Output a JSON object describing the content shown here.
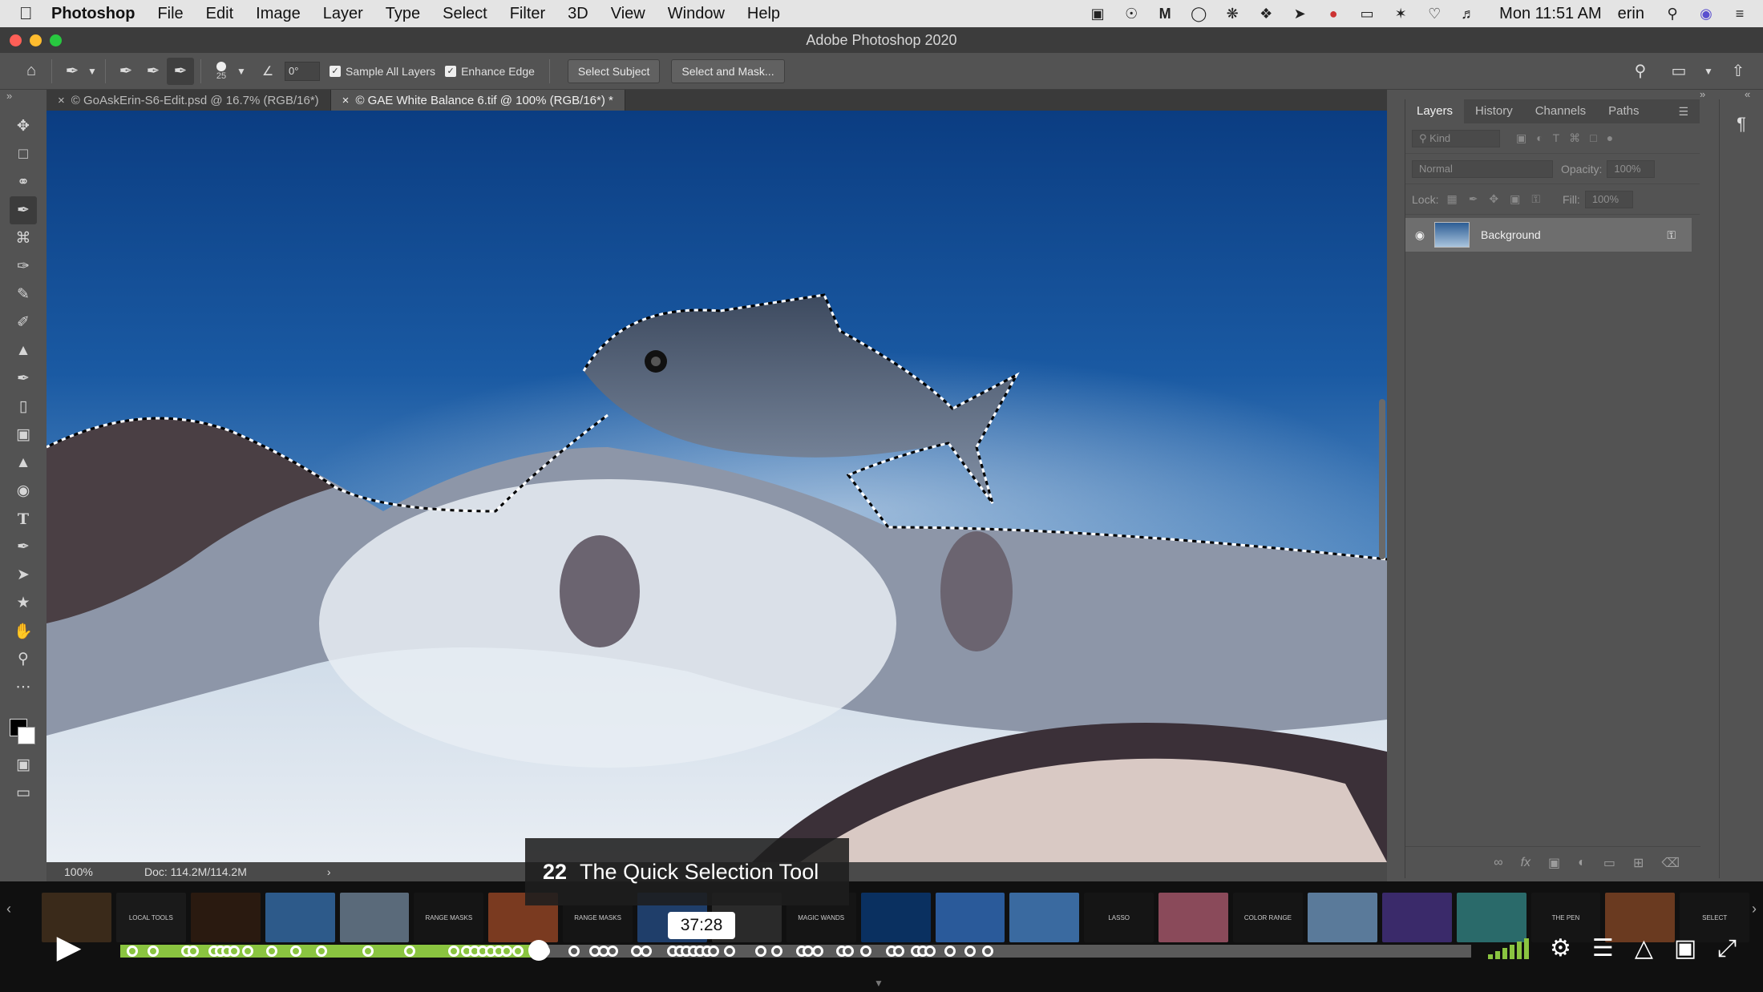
{
  "menubar": {
    "apple": "",
    "app": "Photoshop",
    "items": [
      "File",
      "Edit",
      "Image",
      "Layer",
      "Type",
      "Select",
      "Filter",
      "3D",
      "View",
      "Window",
      "Help"
    ],
    "clock": "Mon 11:51 AM",
    "user": "erin"
  },
  "window": {
    "title": "Adobe Photoshop 2020"
  },
  "options": {
    "brush_size": "25",
    "angle": "0°",
    "sample_all_layers": "Sample All Layers",
    "enhance_edge": "Enhance Edge",
    "select_subject": "Select Subject",
    "select_and_mask": "Select and Mask..."
  },
  "tabs": [
    {
      "label": "© GoAskErin-S6-Edit.psd @ 16.7% (RGB/16*)"
    },
    {
      "label": "© GAE White Balance 6.tif @ 100% (RGB/16*) *"
    }
  ],
  "status": {
    "zoom": "100%",
    "doc": "Doc: 114.2M/114.2M",
    "arrow": "›"
  },
  "layers_panel": {
    "tabs": [
      "Layers",
      "History",
      "Channels",
      "Paths"
    ],
    "kind": "Kind",
    "blend": "Normal",
    "opacity_label": "Opacity:",
    "opacity": "100%",
    "lock_label": "Lock:",
    "fill_label": "Fill:",
    "fill": "100%",
    "layer_name": "Background"
  },
  "video": {
    "chapter_num": "22",
    "chapter_title": "The Quick Selection Tool",
    "time": "37:28",
    "progress": 0.31,
    "chapters": [
      {
        "label": ""
      },
      {
        "label": "LOCAL TOOLS"
      },
      {
        "label": ""
      },
      {
        "label": ""
      },
      {
        "label": ""
      },
      {
        "label": "RANGE MASKS"
      },
      {
        "label": ""
      },
      {
        "label": "RANGE MASKS"
      },
      {
        "label": ""
      },
      {
        "label": ""
      },
      {
        "label": "MAGIC WANDS"
      },
      {
        "label": ""
      },
      {
        "label": ""
      },
      {
        "label": ""
      },
      {
        "label": "LASSO"
      },
      {
        "label": ""
      },
      {
        "label": "COLOR RANGE"
      },
      {
        "label": ""
      },
      {
        "label": ""
      },
      {
        "label": ""
      },
      {
        "label": "THE PEN"
      },
      {
        "label": ""
      },
      {
        "label": "SELECT"
      }
    ],
    "markers": [
      0.005,
      0.02,
      0.045,
      0.05,
      0.065,
      0.07,
      0.075,
      0.08,
      0.09,
      0.108,
      0.126,
      0.145,
      0.179,
      0.21,
      0.243,
      0.252,
      0.258,
      0.264,
      0.27,
      0.276,
      0.282,
      0.29,
      0.31,
      0.332,
      0.347,
      0.354,
      0.36,
      0.378,
      0.385,
      0.405,
      0.41,
      0.415,
      0.42,
      0.425,
      0.43,
      0.435,
      0.447,
      0.47,
      0.482,
      0.5,
      0.505,
      0.512,
      0.53,
      0.535,
      0.548,
      0.567,
      0.572,
      0.585,
      0.59,
      0.595,
      0.61,
      0.625,
      0.638
    ]
  },
  "colors": {
    "accent": "#8ac440"
  }
}
